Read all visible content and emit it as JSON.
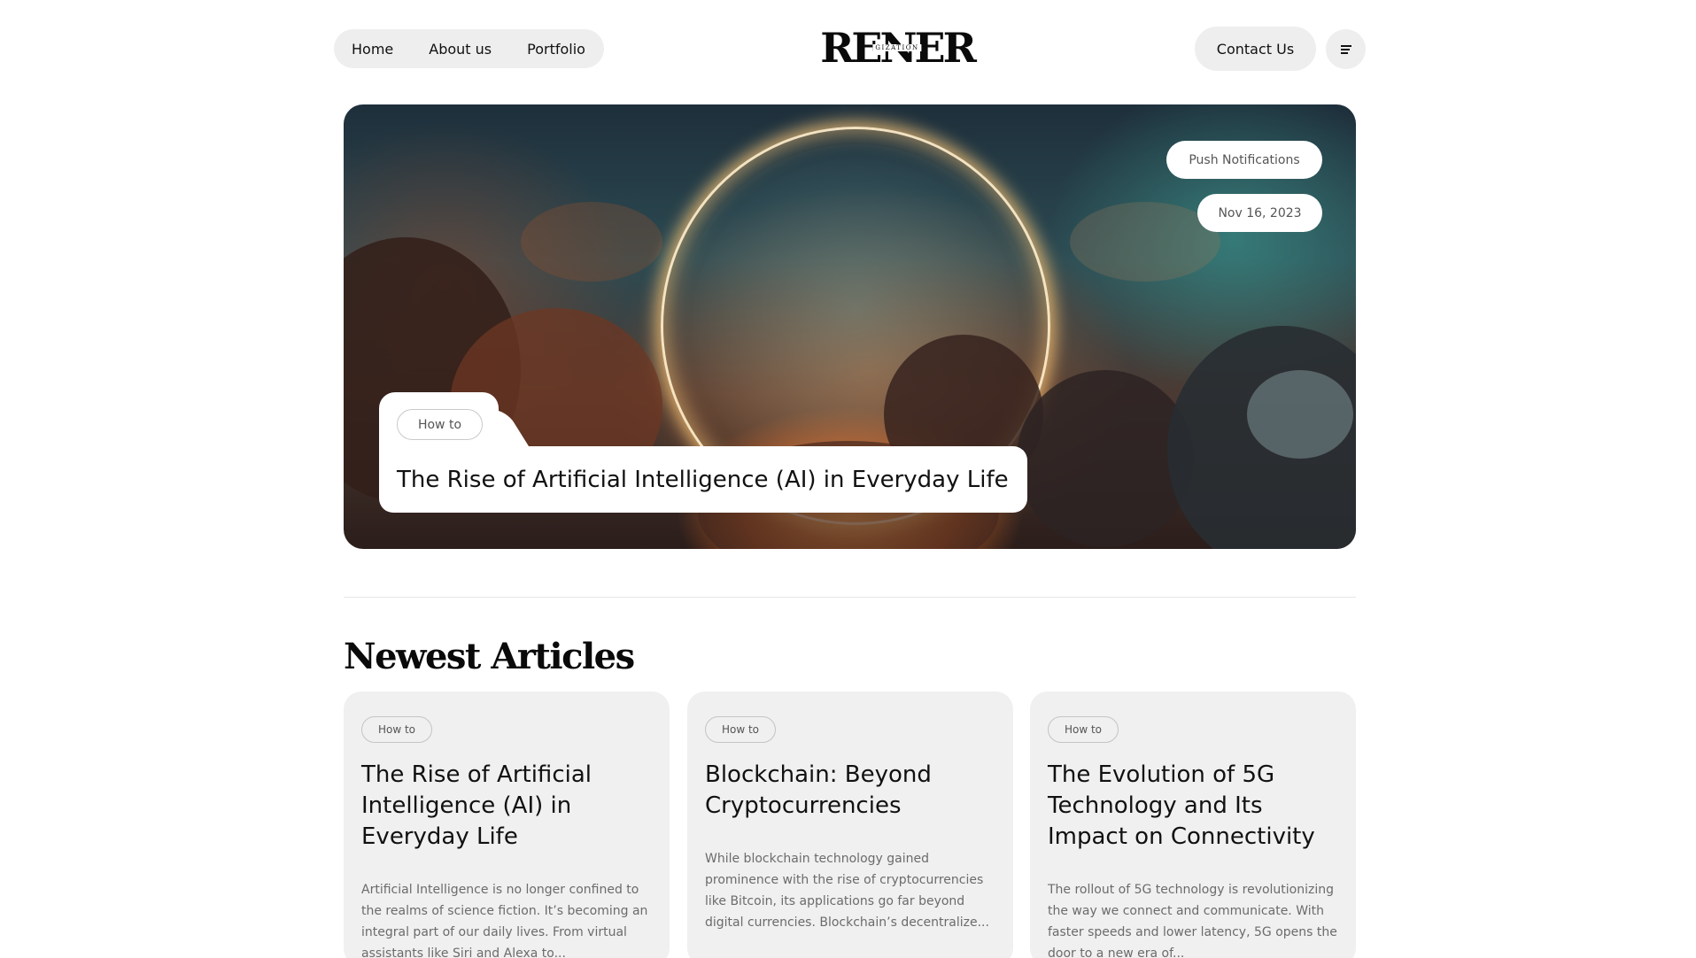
{
  "header": {
    "nav": [
      "Home",
      "About us",
      "Portfolio"
    ],
    "logo_text": "RENER",
    "logo_subtext": "GIZATION",
    "contact_label": "Contact Us",
    "menu_icon": "hamburger-menu-icon"
  },
  "hero": {
    "badge": "Push Notifications",
    "date": "Nov 16, 2023",
    "tag": "How to",
    "title": "The Rise of Artificial Intelligence (AI) in Everyday Life"
  },
  "section": {
    "title": "Newest Articles"
  },
  "articles": [
    {
      "tag": "How to",
      "title": "The Rise of Artificial Intelligence (AI) in Everyday Life",
      "excerpt": "Artificial Intelligence is no longer confined to the realms of science fiction. It’s becoming an integral part of our daily lives. From virtual assistants like Siri and Alexa to..."
    },
    {
      "tag": "How to",
      "title": "Blockchain: Beyond Cryptocurrencies",
      "excerpt": "While blockchain technology gained prominence with the rise of cryptocurrencies like Bitcoin, its applications go far beyond digital currencies. Blockchain’s decentralize..."
    },
    {
      "tag": "How to",
      "title": "The Evolution of 5G Technology and Its Impact on Connectivity",
      "excerpt": "The rollout of 5G technology is revolutionizing the way we connect and communicate. With faster speeds and lower latency, 5G opens the door to a new era of..."
    }
  ]
}
